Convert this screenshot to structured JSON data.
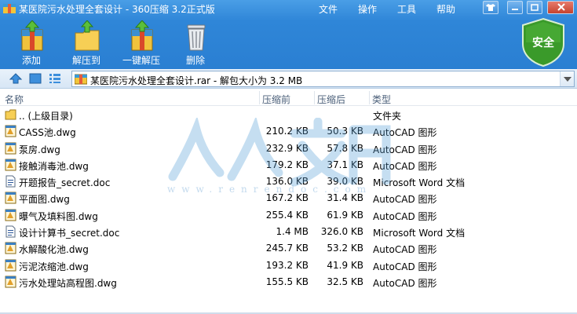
{
  "window": {
    "title": "某医院污水处理全套设计 - 360压缩 3.2正式版",
    "menu": [
      "文件",
      "操作",
      "工具",
      "帮助"
    ]
  },
  "toolbar": {
    "add_label": "添加",
    "extract_to_label": "解压到",
    "one_click_extract_label": "一键解压",
    "delete_label": "删除",
    "safe_badge_label": "安全"
  },
  "address": {
    "path_text": "某医院污水处理全套设计.rar - 解包大小为 3.2 MB"
  },
  "columns": {
    "name": "名称",
    "original": "压缩前",
    "compressed": "压缩后",
    "type": "类型"
  },
  "files": [
    {
      "icon": "folder-up-icon",
      "name": ".. (上级目录)",
      "original": "",
      "compressed": "",
      "type": "文件夹"
    },
    {
      "icon": "dwg-file-icon",
      "name": "CASS池.dwg",
      "original": "210.2 KB",
      "compressed": "50.3 KB",
      "type": "AutoCAD 图形"
    },
    {
      "icon": "dwg-file-icon",
      "name": "泵房.dwg",
      "original": "232.9 KB",
      "compressed": "57.8 KB",
      "type": "AutoCAD 图形"
    },
    {
      "icon": "dwg-file-icon",
      "name": "接触消毒池.dwg",
      "original": "179.2 KB",
      "compressed": "37.1 KB",
      "type": "AutoCAD 图形"
    },
    {
      "icon": "doc-file-icon",
      "name": "开题报告_secret.doc",
      "original": "136.0 KB",
      "compressed": "39.0 KB",
      "type": "Microsoft Word 文档"
    },
    {
      "icon": "dwg-file-icon",
      "name": "平面图.dwg",
      "original": "167.2 KB",
      "compressed": "31.4 KB",
      "type": "AutoCAD 图形"
    },
    {
      "icon": "dwg-file-icon",
      "name": "曝气及填料图.dwg",
      "original": "255.4 KB",
      "compressed": "61.9 KB",
      "type": "AutoCAD 图形"
    },
    {
      "icon": "doc-file-icon",
      "name": "设计计算书_secret.doc",
      "original": "1.4 MB",
      "compressed": "326.0 KB",
      "type": "Microsoft Word 文档"
    },
    {
      "icon": "dwg-file-icon",
      "name": "水解酸化池.dwg",
      "original": "245.7 KB",
      "compressed": "53.2 KB",
      "type": "AutoCAD 图形"
    },
    {
      "icon": "dwg-file-icon",
      "name": "污泥浓缩池.dwg",
      "original": "193.2 KB",
      "compressed": "41.9 KB",
      "type": "AutoCAD 图形"
    },
    {
      "icon": "dwg-file-icon",
      "name": "污水处理站高程图.dwg",
      "original": "155.5 KB",
      "compressed": "32.5 KB",
      "type": "AutoCAD 图形"
    }
  ],
  "watermark": {
    "text": "人人文库",
    "url": "www.renrendoc.com"
  },
  "colors": {
    "titlebar": "#2f86d8",
    "safe_badge": "#3a9a2a",
    "address_bg": "#e9f2fb"
  }
}
